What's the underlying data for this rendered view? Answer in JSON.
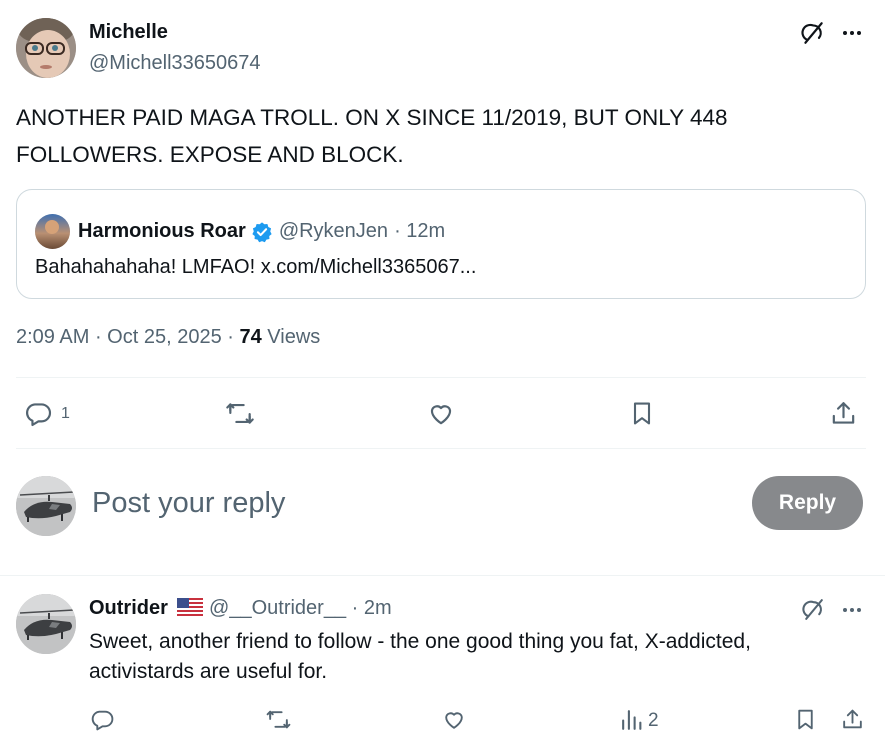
{
  "main_post": {
    "author_name": "Michelle",
    "author_handle": "@Michell33650674",
    "text": "ANOTHER PAID MAGA TROLL.  ON X SINCE 11/2019, BUT ONLY 448 FOLLOWERS.  EXPOSE AND BLOCK.",
    "quote": {
      "author_name": "Harmonious Roar",
      "author_handle": "@RykenJen",
      "time": "· 12m",
      "text": "Bahahahahaha! LMFAO! x.com/Michell3365067..."
    },
    "time": "2:09 AM",
    "date": "Oct 25, 2025",
    "views_count": "74",
    "views_label": "Views",
    "reply_count": "1"
  },
  "composer": {
    "placeholder": "Post your reply",
    "button_label": "Reply"
  },
  "reply_post": {
    "author_name": "Outrider",
    "author_handle": "@__Outrider__",
    "time": "· 2m",
    "text": "Sweet, another friend to follow - the one good thing you fat, X-addicted, activistards are useful for.",
    "views_count": "2"
  },
  "icons": {
    "grok": "grok-icon",
    "more": "more-icon",
    "reply": "reply-icon",
    "repost": "repost-icon",
    "like": "like-icon",
    "bookmark": "bookmark-icon",
    "share": "share-icon",
    "views": "views-icon",
    "verified": "verified-badge-icon",
    "flag": "us-flag-icon"
  },
  "colors": {
    "text": "#0f1419",
    "muted": "#536471",
    "border": "#cfd9de",
    "verified": "#1d9bf0",
    "reply_button_bg": "#87898c"
  }
}
